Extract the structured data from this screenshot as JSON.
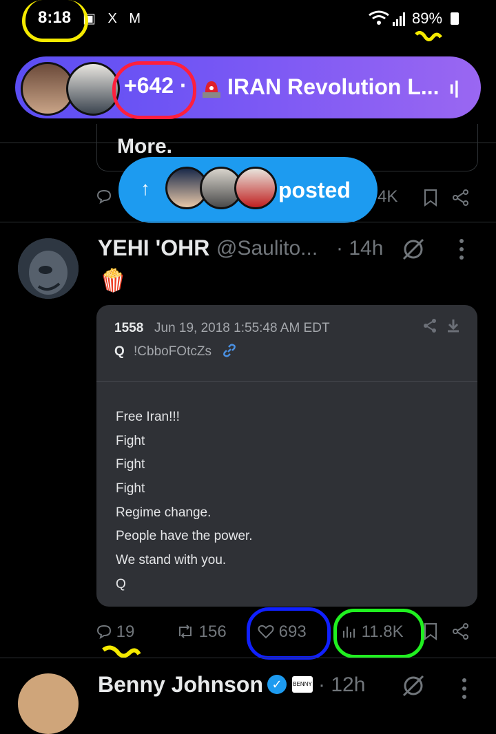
{
  "status_bar": {
    "time": "8:18",
    "notification_icons": "▣ X M",
    "battery": "89%"
  },
  "space": {
    "listener_count": "+642 ·",
    "title": "IRAN Revolution L...",
    "live_indicator": "ı|",
    "accent_color": "#7a58f4"
  },
  "previous_tweet": {
    "more_text": "More.",
    "views_partial": "4K"
  },
  "posted_pill": {
    "arrow": "↑",
    "label": "posted",
    "color": "#1d9bf0"
  },
  "tweet": {
    "author_name": "YEHI 'OHR",
    "handle": "@Saulito...",
    "time": "· 14h",
    "body_emoji": "🍿",
    "quote": {
      "post_number": "1558",
      "date": "Jun 19, 2018 1:55:48 AM EDT",
      "author": "Q",
      "tripcode": "!CbboFOtcZs",
      "lines": [
        "Free Iran!!!",
        "Fight",
        "Fight",
        "Fight",
        "Regime change.",
        "People have the power.",
        "We stand with you.",
        "Q"
      ]
    },
    "actions": {
      "replies": "19",
      "reposts": "156",
      "likes": "693",
      "views": "11.8K"
    }
  },
  "next_tweet": {
    "author_name": "Benny Johnson",
    "badge_text": "BENNY SHOW",
    "time": "· 12h"
  }
}
